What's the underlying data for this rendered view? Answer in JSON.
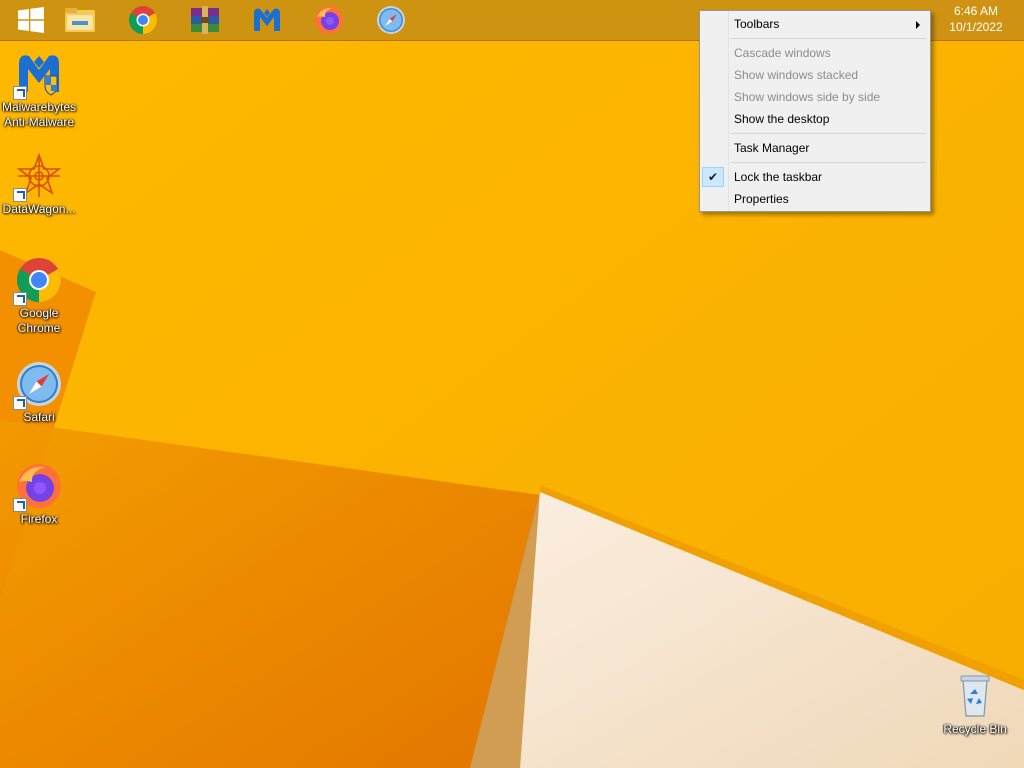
{
  "colors": {
    "wallpaper_base": "#f7b000",
    "wallpaper_dark": "#e37b00",
    "wallpaper_light": "#f4e1c6",
    "taskbar": "#c48b16",
    "menu_bg": "#f0f0f0",
    "menu_check_bg": "#cce8ff"
  },
  "taskbar": {
    "pinned": [
      {
        "name": "Start",
        "icon": "windows-logo-icon"
      },
      {
        "name": "File Explorer",
        "icon": "file-explorer-icon"
      },
      {
        "name": "Google Chrome",
        "icon": "chrome-icon"
      },
      {
        "name": "WinRAR",
        "icon": "winrar-icon"
      },
      {
        "name": "Malwarebytes",
        "icon": "malwarebytes-icon"
      },
      {
        "name": "Firefox",
        "icon": "firefox-icon"
      },
      {
        "name": "Safari",
        "icon": "safari-icon"
      }
    ],
    "clock": {
      "time": "6:46 AM",
      "date": "10/1/2022"
    }
  },
  "desktop": {
    "icons": [
      {
        "label": "Malwarebytes\nAnti-Malware",
        "icon": "malwarebytes-icon"
      },
      {
        "label": "DataWagon...",
        "icon": "datawagon-icon"
      },
      {
        "label": "Google\nChrome",
        "icon": "chrome-icon"
      },
      {
        "label": "Safari",
        "icon": "safari-icon"
      },
      {
        "label": "Firefox",
        "icon": "firefox-icon"
      },
      {
        "label": "Recycle Bin",
        "icon": "recycle-bin-icon"
      }
    ]
  },
  "context_menu": {
    "items": [
      {
        "label": "Toolbars",
        "enabled": true,
        "submenu": true
      },
      {
        "label": "Cascade windows",
        "enabled": false
      },
      {
        "label": "Show windows stacked",
        "enabled": false
      },
      {
        "label": "Show windows side by side",
        "enabled": false
      },
      {
        "label": "Show the desktop",
        "enabled": true
      },
      {
        "label": "Task Manager",
        "enabled": true
      },
      {
        "label": "Lock the taskbar",
        "enabled": true,
        "checked": true
      },
      {
        "label": "Properties",
        "enabled": true
      }
    ]
  }
}
